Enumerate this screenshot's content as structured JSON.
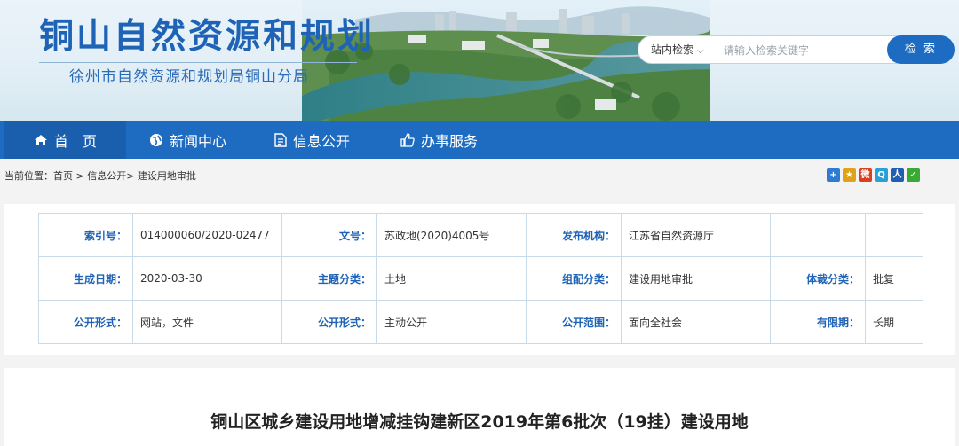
{
  "header": {
    "title": "铜山自然资源和规划",
    "subtitle": "徐州市自然资源和规划局铜山分局"
  },
  "search": {
    "scope_label": "站内检索",
    "placeholder": "请输入检索关键字",
    "button_label": "检 索"
  },
  "nav": {
    "items": [
      {
        "label": "首　页",
        "icon": "home-icon"
      },
      {
        "label": "新闻中心",
        "icon": "globe-icon"
      },
      {
        "label": "信息公开",
        "icon": "document-icon"
      },
      {
        "label": "办事服务",
        "icon": "thumbs-up-icon"
      }
    ]
  },
  "breadcrumb": {
    "text": "当前位置：首页 > 信息公开> 建设用地审批"
  },
  "share": {
    "icons": [
      {
        "name": "share-plus-icon",
        "glyph": "+",
        "color": "#2f7bd1"
      },
      {
        "name": "share-star-icon",
        "glyph": "★",
        "color": "#e0a21b"
      },
      {
        "name": "share-weibo-icon",
        "glyph": "微",
        "color": "#d9401f"
      },
      {
        "name": "share-qzone-icon",
        "glyph": "Q",
        "color": "#2aa0d6"
      },
      {
        "name": "share-renren-icon",
        "glyph": "人",
        "color": "#1f5eb3"
      },
      {
        "name": "share-wechat-icon",
        "glyph": "✓",
        "color": "#3aaa35"
      }
    ]
  },
  "metadata": {
    "rows": [
      {
        "l1": "索引号：",
        "v1": "014000060/2020-02477",
        "l2": "文号：",
        "v2": "苏政地(2020)4005号",
        "l3": "发布机构：",
        "v3": "江苏省自然资源厅",
        "l4": "",
        "v4": ""
      },
      {
        "l1": "生成日期：",
        "v1": "2020-03-30",
        "l2": "主题分类：",
        "v2": "土地",
        "l3": "组配分类：",
        "v3": "建设用地审批",
        "l4": "体裁分类：",
        "v4": "批复"
      },
      {
        "l1": "公开形式：",
        "v1": "网站，文件",
        "l2": "公开形式：",
        "v2": "主动公开",
        "l3": "公开范围：",
        "v3": "面向全社会",
        "l4": "有限期：",
        "v4": "长期"
      }
    ]
  },
  "document": {
    "title": "铜山区城乡建设用地增减挂钩建新区2019年第6批次（19挂）建设用地"
  },
  "colors": {
    "brand_blue": "#1e6cc1",
    "label_blue": "#1e63b5"
  }
}
